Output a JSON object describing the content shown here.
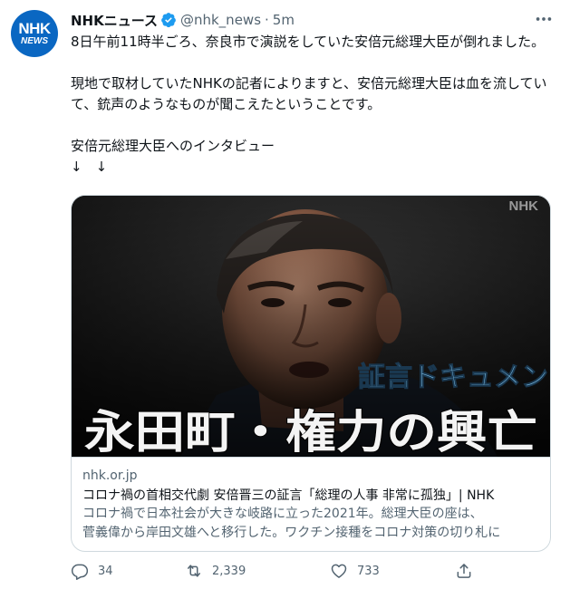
{
  "account": {
    "avatar_line1": "NHK",
    "avatar_line2": "NEWS",
    "name": "NHKニュース",
    "handle": "@nhk_news",
    "separator": "·",
    "time": "5m",
    "verified": true
  },
  "tweet_text": {
    "line1": "8日午前11時半ごろ、奈良市で演説をしていた安倍元総理大臣が倒れました。",
    "line2": "現地で取材していたNHKの記者によりますと、安倍元総理大臣は血を流していて、銃声のようなものが聞こえたということです。",
    "line3": "安倍元総理大臣へのインタビュー",
    "line4": "↓　↓"
  },
  "card": {
    "watermark": "NHK",
    "image_subtitle": "証言ドキュメント",
    "image_title": "永田町・権力の興亡",
    "domain": "nhk.or.jp",
    "title": "コロナ禍の首相交代劇 安倍晋三の証言「総理の人事 非常に孤独」| NHK",
    "desc_line1": "コロナ禍で日本社会が大きな岐路に立った2021年。総理大臣の座は、",
    "desc_line2": "菅義偉から岸田文雄へと移行した。ワクチン接種をコロナ対策の切り札に"
  },
  "actions": {
    "reply_count": "34",
    "retweet_count": "2,339",
    "like_count": "733"
  },
  "icons": {
    "reply": "reply-icon",
    "retweet": "retweet-icon",
    "like": "heart-icon",
    "share": "share-icon",
    "more": "more-icon",
    "verified": "verified-badge-icon"
  },
  "colors": {
    "brand_blue": "#0a67c2",
    "verified_blue": "#1d9bf0",
    "muted_text": "#536471",
    "card_subtitle_blue": "#7fc4ee"
  }
}
